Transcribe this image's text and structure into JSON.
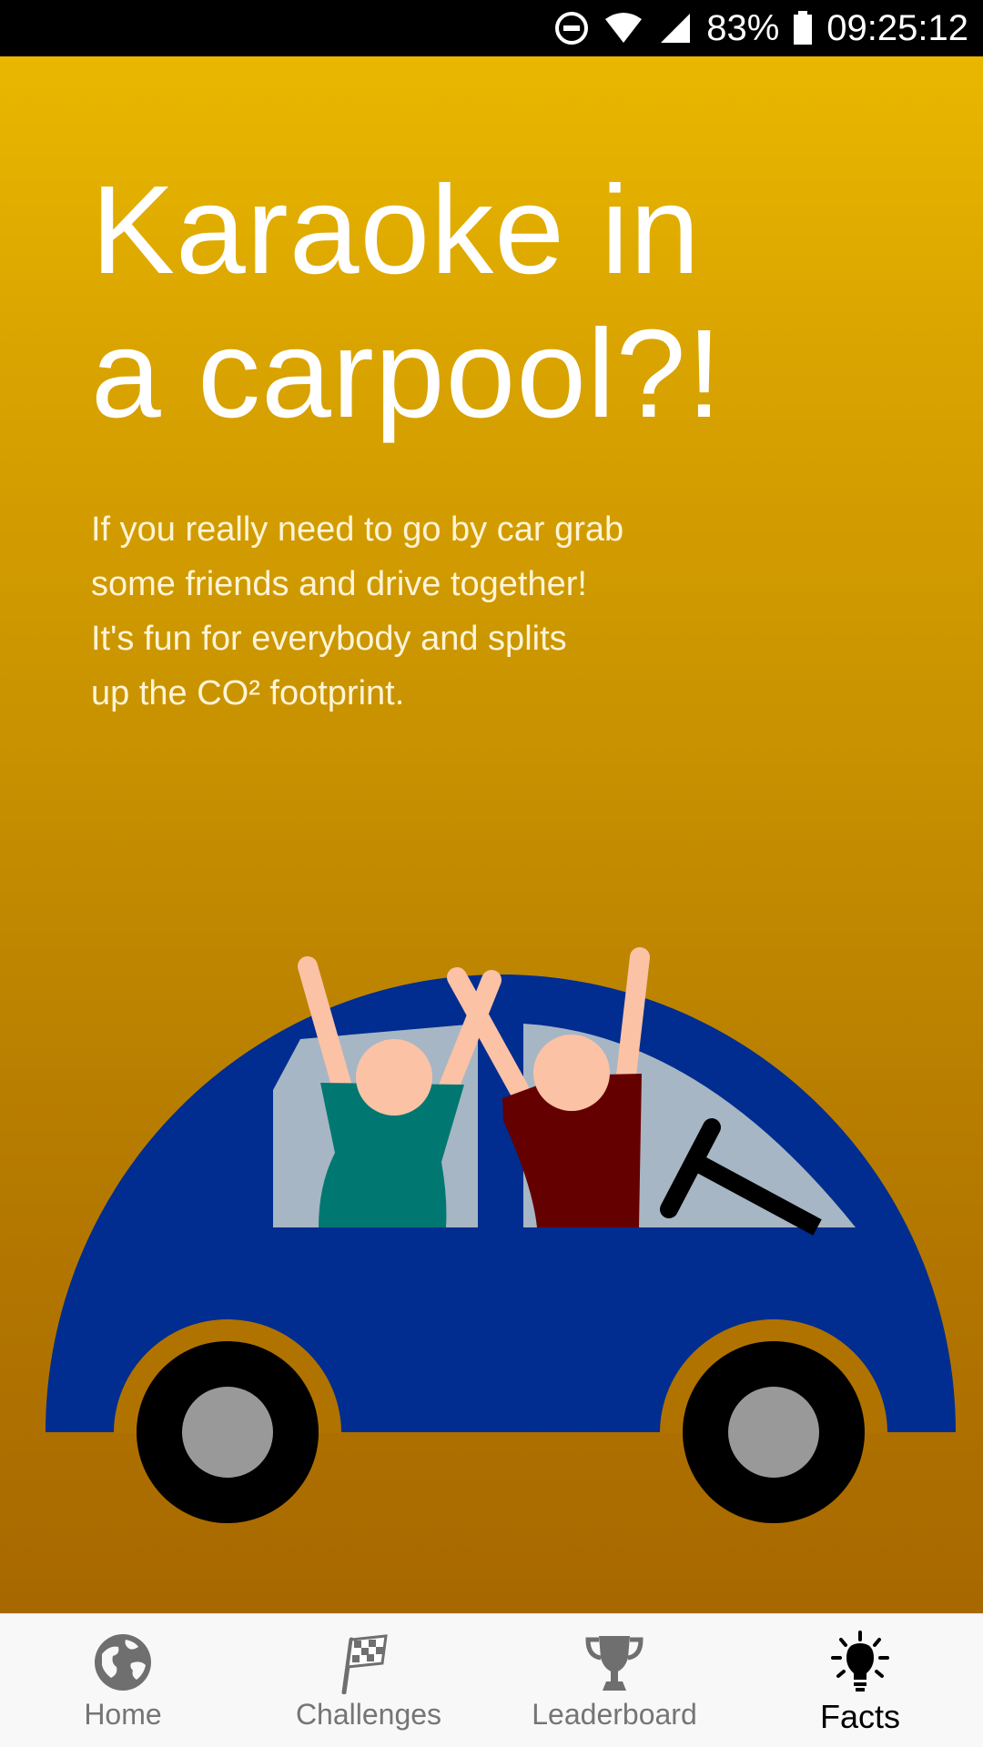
{
  "status_bar": {
    "battery_percent": "83%",
    "time": "09:25:12",
    "icons": [
      "do-not-disturb-icon",
      "wifi-icon",
      "cell-signal-icon",
      "battery-icon"
    ]
  },
  "fact": {
    "title_line1": "Karaoke in",
    "title_line2": "a carpool?!",
    "body_lines": [
      "If you really need to go by car grab",
      "some friends and drive together!",
      "It's fun for everybody and splits",
      "up the CO² footprint."
    ]
  },
  "bottom_nav": {
    "items": [
      {
        "label": "Home",
        "icon": "globe-icon",
        "active": false
      },
      {
        "label": "Challenges",
        "icon": "checkered-flag-icon",
        "active": false
      },
      {
        "label": "Leaderboard",
        "icon": "trophy-icon",
        "active": false
      },
      {
        "label": "Facts",
        "icon": "lightbulb-icon",
        "active": true
      }
    ]
  },
  "colors": {
    "gradient_top": "#e9b700",
    "gradient_bottom": "#a86800",
    "car_body": "#002d8f",
    "window": "#a7b6c4",
    "person_left_shirt": "#007871",
    "person_right_shirt": "#650000",
    "skin": "#fbc2a5",
    "tire": "#000000",
    "hubcap": "#999999",
    "nav_active": "#000000",
    "nav_inactive": "#757575"
  }
}
